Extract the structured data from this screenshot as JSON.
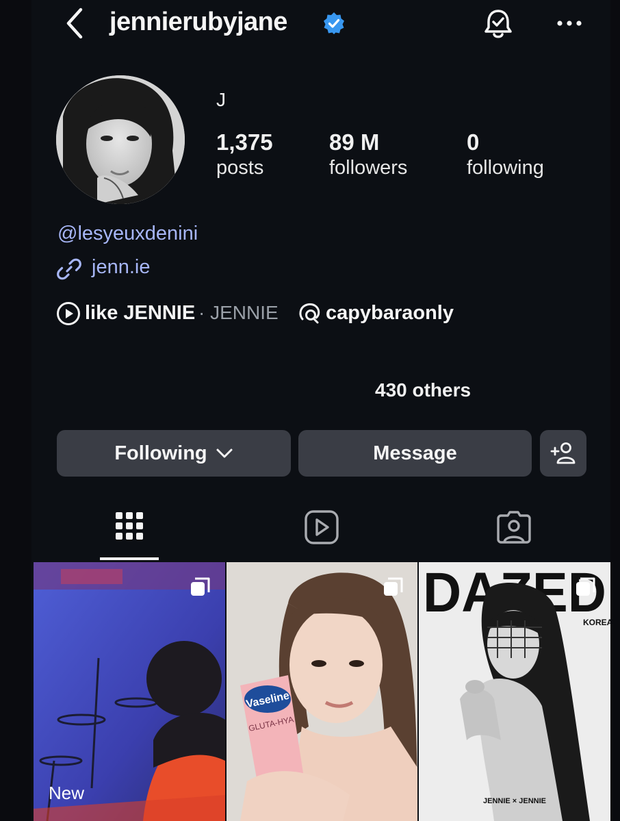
{
  "header": {
    "username": "jennierubyjane",
    "back_icon": "chevron-left-icon",
    "verified_icon": "verified-badge-icon",
    "bell_icon": "bell-check-icon",
    "more_icon": "more-horizontal-icon"
  },
  "profile": {
    "display_name": "J",
    "stats": [
      {
        "value": "1,375",
        "label": "posts"
      },
      {
        "value": "89 M",
        "label": "followers"
      },
      {
        "value": "0",
        "label": "following"
      }
    ],
    "mention": "@lesyeuxdenini",
    "link": "jenn.ie",
    "music": {
      "song": "like JENNIE",
      "artist": "· JENNIE"
    },
    "threads_handle": "capybaraonly",
    "followed_by_suffix": "430 others"
  },
  "actions": {
    "following_label": "Following",
    "message_label": "Message",
    "add_icon": "add-person-icon"
  },
  "tabs": [
    {
      "name": "grid",
      "icon": "grid-icon",
      "selected": true
    },
    {
      "name": "reels",
      "icon": "reels-icon",
      "selected": false
    },
    {
      "name": "tagged",
      "icon": "tagged-icon",
      "selected": false
    }
  ],
  "grid": {
    "posts": [
      {
        "badge": "New",
        "multi": true
      },
      {
        "badge": "",
        "multi": true
      },
      {
        "badge": "",
        "multi": true
      }
    ],
    "dazed_title": "DAZED",
    "dazed_sub": "KOREA",
    "dazed_caption": "JENNIE × JENNIE",
    "vaseline_text": "Vaseline",
    "vaseline_sub": "GLUTA-HYA"
  },
  "colors": {
    "background": "#0c0f14",
    "link": "#a7b6f7",
    "verified": "#3897f0",
    "button": "#3a3d45"
  }
}
